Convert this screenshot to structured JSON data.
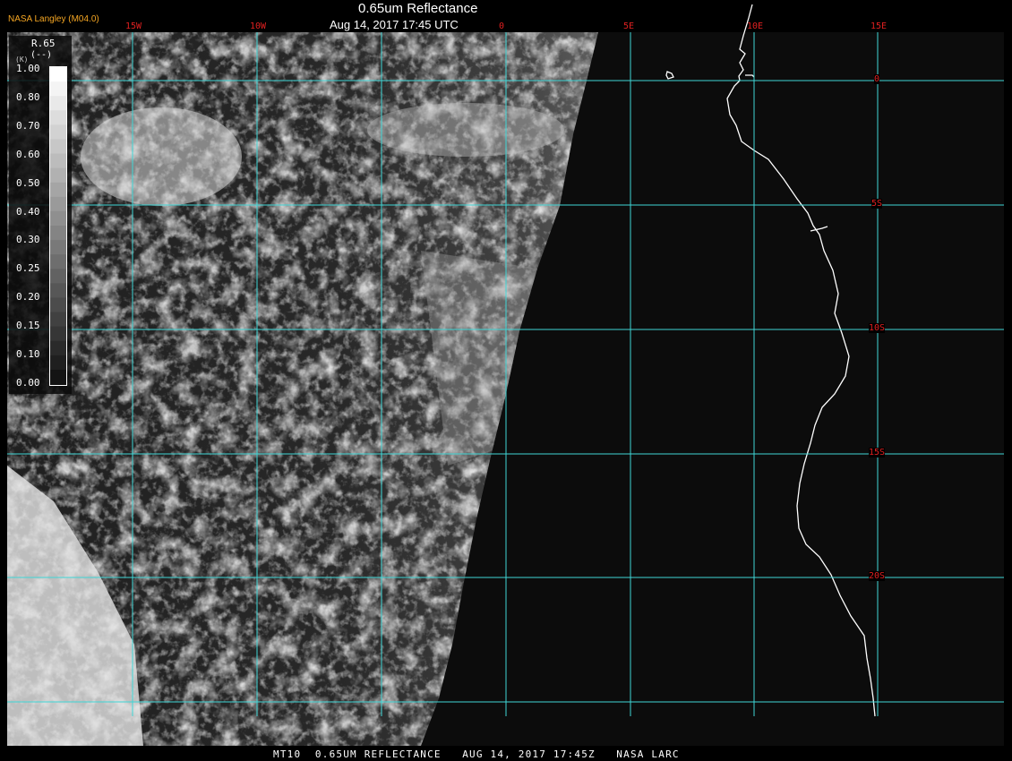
{
  "header": {
    "title": "0.65um Reflectance",
    "subtitle": "Aug 14, 2017 17:45 UTC",
    "brand": "NASA Langley (M04.0)"
  },
  "colorbar": {
    "title": "R.65",
    "units": "(--)",
    "small_label": "(K)",
    "ticks": [
      "1.00",
      "0.80",
      "0.70",
      "0.60",
      "0.50",
      "0.40",
      "0.30",
      "0.25",
      "0.20",
      "0.15",
      "0.10",
      "0.00"
    ]
  },
  "grid": {
    "lon_labels": [
      "15W",
      "10W",
      "0",
      "5E",
      "10E",
      "15E"
    ],
    "lat_labels": [
      "0",
      "5S",
      "10S",
      "15S",
      "20S"
    ],
    "line_color": "#3fd6d6",
    "label_color": "#e02020"
  },
  "footer": {
    "text": "MT10  0.65UM REFLECTANCE   AUG 14, 2017 17:45Z   NASA LARC"
  },
  "colors": {
    "background": "#000000",
    "coastline": "#ffffff",
    "brand": "#f5a623"
  }
}
